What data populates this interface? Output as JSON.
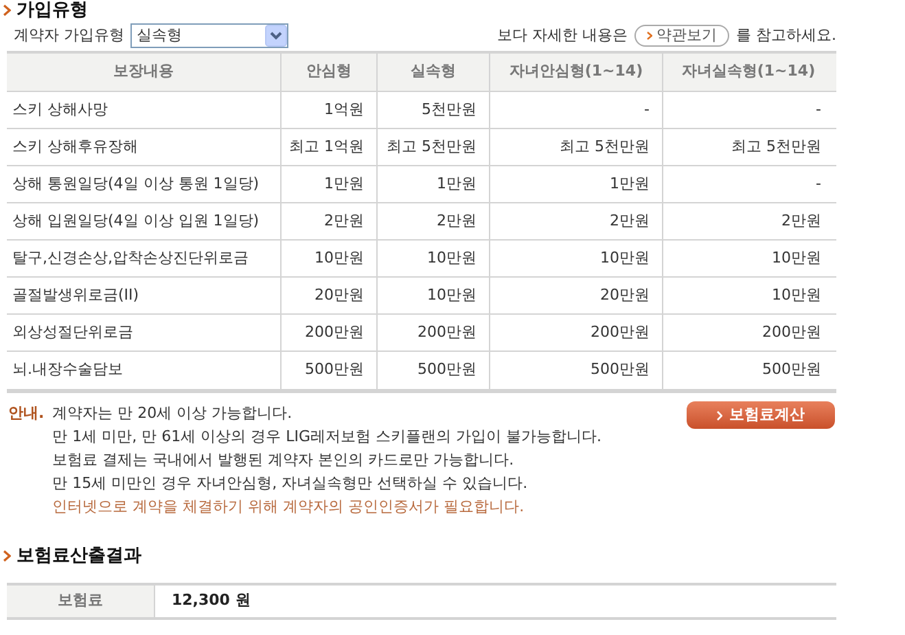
{
  "section_title": "가입유형",
  "plan_selector": {
    "label": "계약자 가입유형",
    "value": "실속형"
  },
  "reference": {
    "prefix": "보다 자세한 내용은",
    "button": "약관보기",
    "suffix": "를 참고하세요."
  },
  "table": {
    "columns": [
      "보장내용",
      "안심형",
      "실속형",
      "자녀안심형(1~14)",
      "자녀실속형(1~14)"
    ],
    "rows": [
      {
        "cells": [
          "스키 상해사망",
          "1억원",
          "5천만원",
          "-",
          "-"
        ]
      },
      {
        "cells": [
          "스키 상해후유장해",
          "최고 1억원",
          "최고 5천만원",
          "최고 5천만원",
          "최고 5천만원"
        ]
      },
      {
        "cells": [
          "상해 통원일당(4일 이상 통원 1일당)",
          "1만원",
          "1만원",
          "1만원",
          "-"
        ]
      },
      {
        "cells": [
          "상해 입원일당(4일 이상 입원 1일당)",
          "2만원",
          "2만원",
          "2만원",
          "2만원"
        ]
      },
      {
        "cells": [
          "탈구,신경손상,압착손상진단위로금",
          "10만원",
          "10만원",
          "10만원",
          "10만원"
        ]
      },
      {
        "cells": [
          "골절발생위로금(II)",
          "20만원",
          "10만원",
          "20만원",
          "10만원"
        ]
      },
      {
        "cells": [
          "외상성절단위로금",
          "200만원",
          "200만원",
          "200만원",
          "200만원"
        ]
      },
      {
        "cells": [
          "뇌.내장수술담보",
          "500만원",
          "500만원",
          "500만원",
          "500만원"
        ]
      }
    ]
  },
  "notice": {
    "label": "안내.",
    "lines": [
      {
        "text": "계약자는 만 20세 이상 가능합니다.",
        "kind": "normal"
      },
      {
        "text": "만 1세 미만, 만 61세 이상의 경우 LIG레저보험 스키플랜의 가입이 불가능합니다.",
        "kind": "normal"
      },
      {
        "text": "보험료 결제는 국내에서 발행된 계약자 본인의 카드로만 가능합니다.",
        "kind": "normal"
      },
      {
        "text": "만 15세 미만인 경우 자녀안심형, 자녀실속형만 선택하실 수 있습니다.",
        "kind": "normal"
      },
      {
        "text": "인터넷으로 계약을 체결하기 위해 계약자의 공인인증서가 필요합니다.",
        "kind": "highlight"
      }
    ]
  },
  "calculate_button": "보험료계산",
  "result": {
    "title": "보험료산출결과",
    "label": "보험료",
    "value": "12,300 원"
  }
}
